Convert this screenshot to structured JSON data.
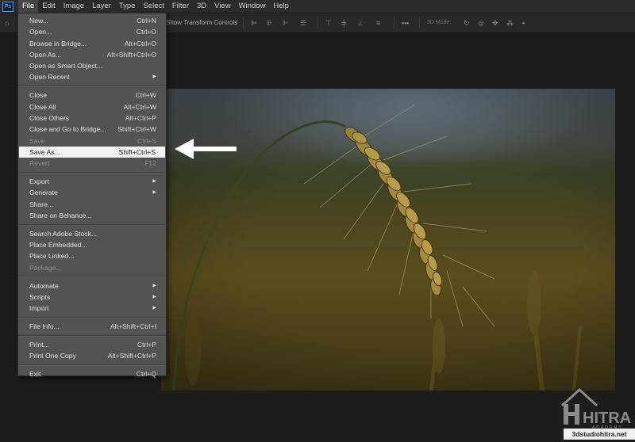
{
  "app": {
    "logo_text": "Ps"
  },
  "menubar": {
    "items": [
      "File",
      "Edit",
      "Image",
      "Layer",
      "Type",
      "Select",
      "Filter",
      "3D",
      "View",
      "Window",
      "Help"
    ]
  },
  "options_bar": {
    "transform_label": "Show Transform Controls",
    "mode_label": "3D Mode:"
  },
  "file_menu": {
    "groups": [
      [
        {
          "label": "New...",
          "shortcut": "Ctrl+N"
        },
        {
          "label": "Open...",
          "shortcut": "Ctrl+O"
        },
        {
          "label": "Browse in Bridge...",
          "shortcut": "Alt+Ctrl+O"
        },
        {
          "label": "Open As...",
          "shortcut": "Alt+Shift+Ctrl+O"
        },
        {
          "label": "Open as Smart Object...",
          "shortcut": ""
        },
        {
          "label": "Open Recent",
          "shortcut": "",
          "submenu": true
        }
      ],
      [
        {
          "label": "Close",
          "shortcut": "Ctrl+W"
        },
        {
          "label": "Close All",
          "shortcut": "Alt+Ctrl+W"
        },
        {
          "label": "Close Others",
          "shortcut": "Alt+Ctrl+P"
        },
        {
          "label": "Close and Go to Bridge...",
          "shortcut": "Shift+Ctrl+W"
        },
        {
          "label": "Save",
          "shortcut": "Ctrl+S",
          "disabled": true
        },
        {
          "label": "Save As...",
          "shortcut": "Shift+Ctrl+S",
          "highlighted": true
        },
        {
          "label": "Revert",
          "shortcut": "F12",
          "disabled": true
        }
      ],
      [
        {
          "label": "Export",
          "shortcut": "",
          "submenu": true
        },
        {
          "label": "Generate",
          "shortcut": "",
          "submenu": true
        },
        {
          "label": "Share...",
          "shortcut": ""
        },
        {
          "label": "Share on Behance...",
          "shortcut": ""
        }
      ],
      [
        {
          "label": "Search Adobe Stock...",
          "shortcut": ""
        },
        {
          "label": "Place Embedded...",
          "shortcut": ""
        },
        {
          "label": "Place Linked...",
          "shortcut": ""
        },
        {
          "label": "Package...",
          "shortcut": "",
          "disabled": true
        }
      ],
      [
        {
          "label": "Automate",
          "shortcut": "",
          "submenu": true
        },
        {
          "label": "Scripts",
          "shortcut": "",
          "submenu": true
        },
        {
          "label": "Import",
          "shortcut": "",
          "submenu": true
        }
      ],
      [
        {
          "label": "File Info...",
          "shortcut": "Alt+Shift+Ctrl+I"
        }
      ],
      [
        {
          "label": "Print...",
          "shortcut": "Ctrl+P"
        },
        {
          "label": "Print One Copy",
          "shortcut": "Alt+Shift+Ctrl+P"
        }
      ],
      [
        {
          "label": "Exit",
          "shortcut": "Ctrl+Q"
        }
      ]
    ]
  },
  "watermark": {
    "brand": "HITRA",
    "subtitle": "ACADEMY",
    "url": "3dstudiohitra.net"
  },
  "colors": {
    "menu_bg": "#535353",
    "highlight_bg": "#f2f2f2",
    "app_bg": "#1c1c1c",
    "accent": "#31a8ff"
  }
}
